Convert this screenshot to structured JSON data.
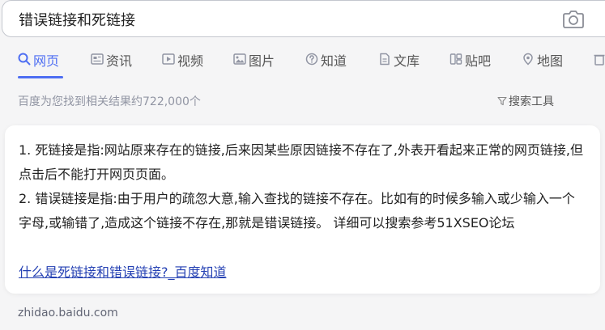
{
  "search": {
    "query": "错误链接和死链接"
  },
  "icons": {
    "camera": "camera-icon",
    "webpage": "search-icon",
    "news": "newspaper-icon",
    "video": "play-icon",
    "image": "image-icon",
    "zhidao": "question-icon",
    "wenku": "document-icon",
    "tieba": "forum-icon",
    "map": "map-icon",
    "tools": "filter-icon"
  },
  "colors": {
    "accent": "#4e6ef2",
    "link": "#2440b3"
  },
  "tabs": [
    {
      "label": "网页",
      "active": true
    },
    {
      "label": "资讯"
    },
    {
      "label": "视频"
    },
    {
      "label": "图片"
    },
    {
      "label": "知道"
    },
    {
      "label": "文库"
    },
    {
      "label": "贴吧"
    },
    {
      "label": "地图"
    }
  ],
  "results": {
    "count_text": "百度为您找到相关结果约722,000个",
    "tools_label": "搜索工具"
  },
  "answer": {
    "p1": "1. 死链接是指:网站原来存在的链接,后来因某些原因链接不存在了,外表开看起来正常的网页链接,但点击后不能打开网页页面。",
    "p2": "2. 错误链接是指:由于用户的疏忽大意,输入查找的链接不存在。比如有的时候多输入或少输入一个字母,或输错了,造成这个链接不存在,那就是错误链接。 详细可以搜索参考51XSEO论坛",
    "link_text": "什么是死链接和错误链接?_百度知道",
    "source": "zhidao.baidu.com"
  }
}
